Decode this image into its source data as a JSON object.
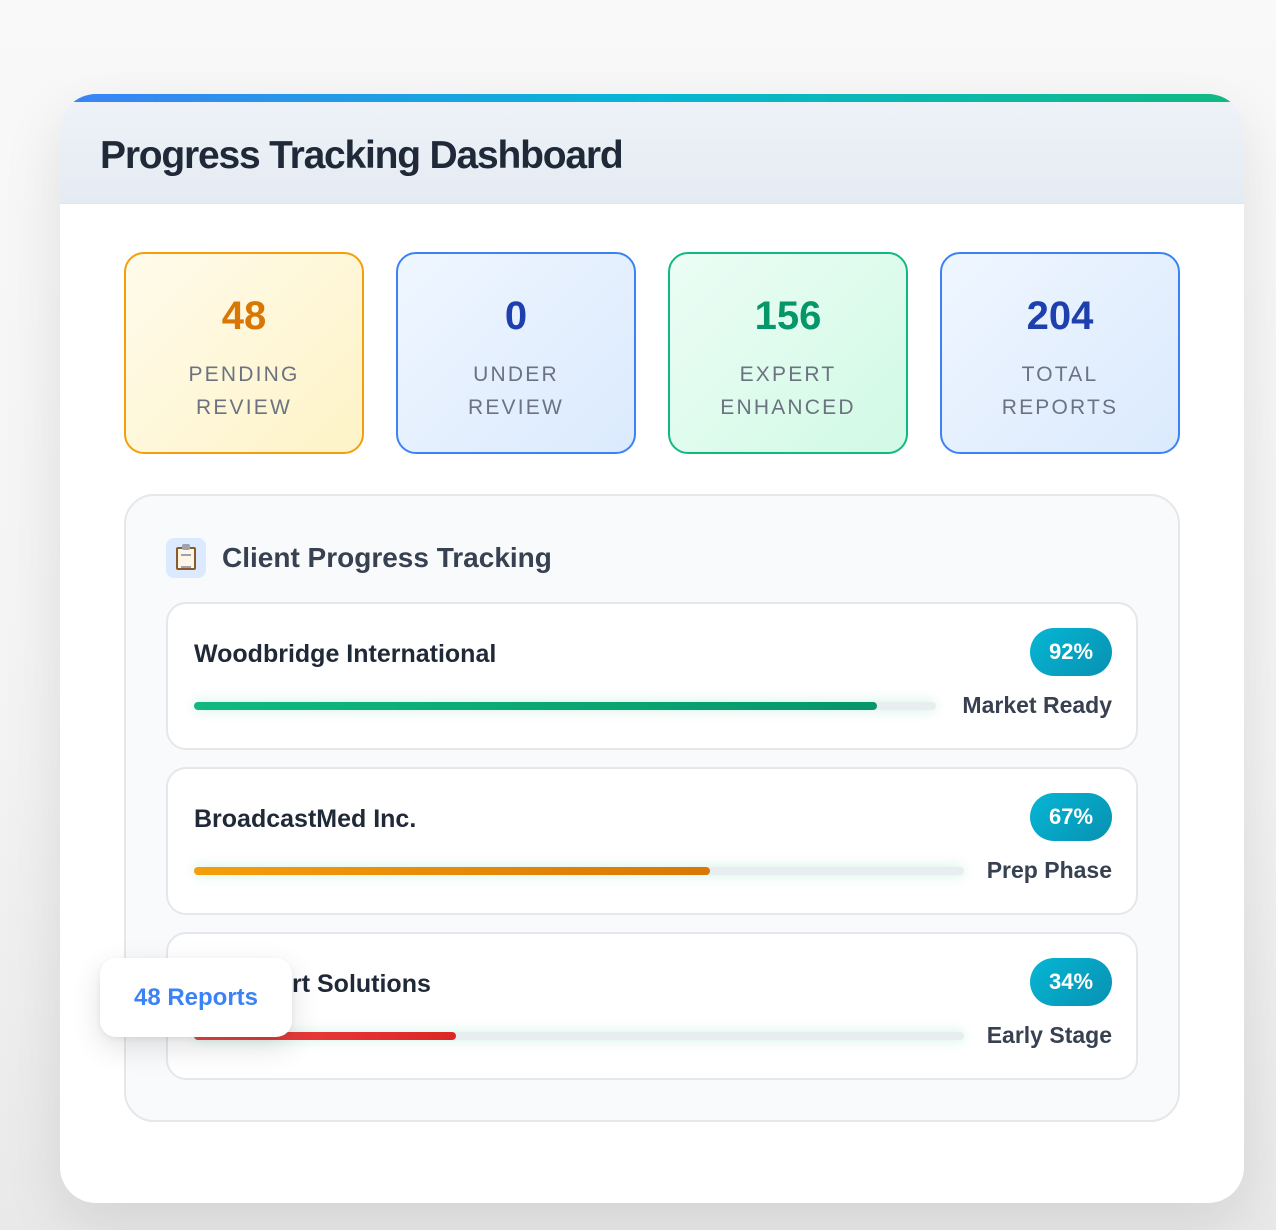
{
  "header": {
    "title": "Progress Tracking Dashboard"
  },
  "stats": [
    {
      "value": "48",
      "label_line1": "PENDING",
      "label_line2": "REVIEW"
    },
    {
      "value": "0",
      "label_line1": "UNDER",
      "label_line2": "REVIEW"
    },
    {
      "value": "156",
      "label_line1": "EXPERT",
      "label_line2": "ENHANCED"
    },
    {
      "value": "204",
      "label_line1": "TOTAL",
      "label_line2": "REPORTS"
    }
  ],
  "panel": {
    "icon": "clipboard-icon",
    "title": "Client Progress Tracking",
    "clients": [
      {
        "name": "Woodbridge International",
        "percent_label": "92%",
        "progress": 0.92,
        "stage": "Market Ready"
      },
      {
        "name": "BroadcastMed Inc.",
        "percent_label": "67%",
        "progress": 0.67,
        "stage": "Prep Phase"
      },
      {
        "name": "rt Solutions",
        "percent_label": "34%",
        "progress": 0.34,
        "stage": "Early Stage"
      }
    ]
  },
  "tooltip": {
    "text": "48 Reports"
  },
  "colors": {
    "accent_blue": "#3b82f6",
    "accent_cyan": "#06b6d4",
    "accent_green": "#10b981",
    "pending_orange": "#d97706",
    "early_red": "#dc2626"
  }
}
